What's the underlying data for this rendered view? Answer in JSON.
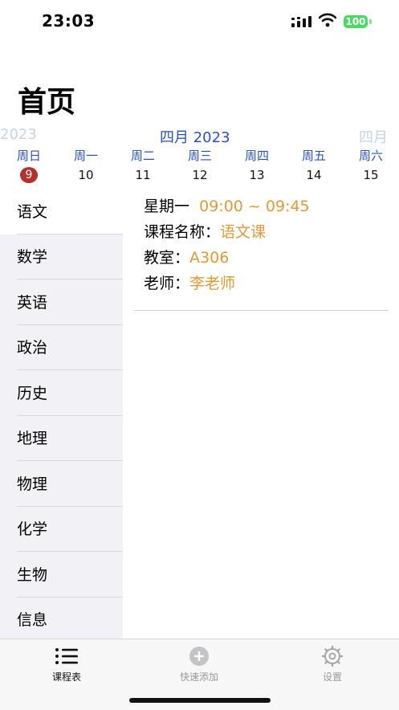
{
  "status_bar": {
    "time": "23:03",
    "battery": "100"
  },
  "page_title": "首页",
  "month_strip": {
    "prev": "2023",
    "current": "四月 2023",
    "next": "四月"
  },
  "week": [
    {
      "weekday": "周日",
      "date": "9",
      "today": true
    },
    {
      "weekday": "周一",
      "date": "10"
    },
    {
      "weekday": "周二",
      "date": "11"
    },
    {
      "weekday": "周三",
      "date": "12"
    },
    {
      "weekday": "周四",
      "date": "13"
    },
    {
      "weekday": "周五",
      "date": "14"
    },
    {
      "weekday": "周六",
      "date": "15"
    }
  ],
  "subjects": [
    "语文",
    "数学",
    "英语",
    "政治",
    "历史",
    "地理",
    "物理",
    "化学",
    "生物",
    "信息"
  ],
  "detail": {
    "weekday_label": "星期一",
    "time_range": "09:00 ~ 09:45",
    "course_label": "课程名称：",
    "course_value": "语文课",
    "room_label": "教室：",
    "room_value": "A306",
    "teacher_label": "老师：",
    "teacher_value": "李老师"
  },
  "tabs": [
    {
      "label": "课程表",
      "icon": "list-icon"
    },
    {
      "label": "快速添加",
      "icon": "plus-circle-icon"
    },
    {
      "label": "设置",
      "icon": "gear-icon"
    }
  ],
  "colors": {
    "accent_blue": "#2a52be",
    "accent_orange": "#e29a35",
    "today_red": "#b3312c"
  }
}
